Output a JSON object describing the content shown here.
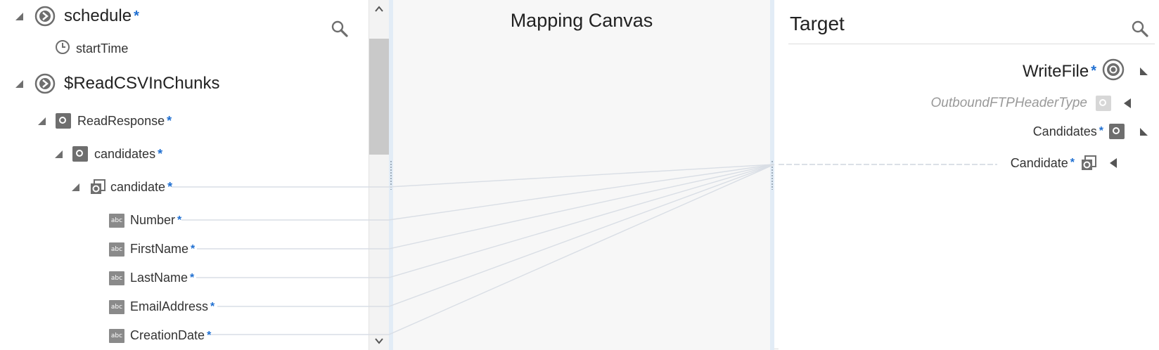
{
  "source": {
    "items": [
      {
        "label": "schedule",
        "required": "*"
      },
      {
        "label": "startTime",
        "required": ""
      },
      {
        "label": "$ReadCSVInChunks",
        "required": ""
      },
      {
        "label": "ReadResponse",
        "required": "*"
      },
      {
        "label": "candidates",
        "required": "*"
      },
      {
        "label": "candidate",
        "required": "*"
      },
      {
        "label": "Number",
        "required": "*"
      },
      {
        "label": "FirstName",
        "required": "*"
      },
      {
        "label": "LastName",
        "required": "*"
      },
      {
        "label": "EmailAddress",
        "required": "*"
      },
      {
        "label": "CreationDate",
        "required": "*"
      }
    ],
    "type_badge": "abc"
  },
  "canvas": {
    "title": "Mapping Canvas"
  },
  "target": {
    "title": "Target",
    "items": [
      {
        "label": "WriteFile",
        "required": "*"
      },
      {
        "label": "OutboundFTPHeaderType",
        "required": ""
      },
      {
        "label": "Candidates",
        "required": "*"
      },
      {
        "label": "Candidate",
        "required": "*"
      }
    ]
  },
  "colors": {
    "required_star": "#1f6fd1",
    "link_line": "#d9dee5",
    "splitter": "#e2ecf6",
    "canvas_bg": "#f7f7f7"
  },
  "icons": {
    "search": "search-icon",
    "scroll_up": "chevron-up-icon",
    "scroll_down": "chevron-down-icon"
  }
}
